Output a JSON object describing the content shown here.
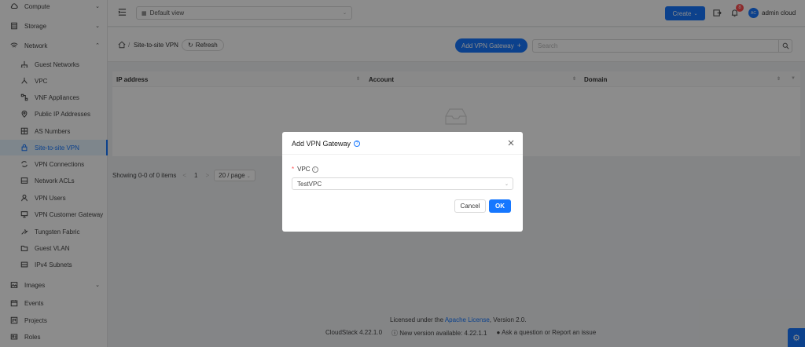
{
  "sidebar": {
    "items": [
      {
        "label": "Compute",
        "icon": "cloud-icon",
        "kind": "top",
        "chevron": "down"
      },
      {
        "label": "Storage",
        "icon": "database-icon",
        "kind": "top",
        "chevron": "down"
      },
      {
        "label": "Network",
        "icon": "wifi-icon",
        "kind": "top",
        "chevron": "up"
      },
      {
        "label": "Guest Networks",
        "icon": "apartment-icon",
        "kind": "sub"
      },
      {
        "label": "VPC",
        "icon": "deployment-unit-icon",
        "kind": "sub"
      },
      {
        "label": "VNF Appliances",
        "icon": "gateway-icon",
        "kind": "sub"
      },
      {
        "label": "Public IP Addresses",
        "icon": "environment-icon",
        "kind": "sub"
      },
      {
        "label": "AS Numbers",
        "icon": "partition-icon",
        "kind": "sub"
      },
      {
        "label": "Site-to-site VPN",
        "icon": "lock-icon",
        "kind": "sub",
        "active": true
      },
      {
        "label": "VPN Connections",
        "icon": "sync-icon",
        "kind": "sub"
      },
      {
        "label": "Network ACLs",
        "icon": "hdd-icon",
        "kind": "sub"
      },
      {
        "label": "VPN Users",
        "icon": "user-icon",
        "kind": "sub"
      },
      {
        "label": "VPN Customer Gateway",
        "icon": "desktop-icon",
        "kind": "sub"
      },
      {
        "label": "Tungsten Fabric",
        "icon": "tool-icon",
        "kind": "sub"
      },
      {
        "label": "Guest VLAN",
        "icon": "folder-icon",
        "kind": "sub"
      },
      {
        "label": "IPv4 Subnets",
        "icon": "block-icon",
        "kind": "sub"
      },
      {
        "label": "Images",
        "icon": "picture-icon",
        "kind": "top",
        "chevron": "down"
      },
      {
        "label": "Events",
        "icon": "schedule-icon",
        "kind": "top"
      },
      {
        "label": "Projects",
        "icon": "project-icon",
        "kind": "top"
      },
      {
        "label": "Roles",
        "icon": "idcard-icon",
        "kind": "top"
      }
    ]
  },
  "header": {
    "view_select": "Default view",
    "create_label": "Create",
    "notification_count": "8",
    "avatar_initials": "AC",
    "username": "admin cloud"
  },
  "toolbar": {
    "breadcrumb_current": "Site-to-site VPN",
    "breadcrumb_sep": "/",
    "refresh_label": "Refresh",
    "add_label": "Add VPN Gateway",
    "search_placeholder": "Search"
  },
  "table": {
    "columns": [
      "IP address",
      "Account",
      "Domain"
    ],
    "rows": []
  },
  "pagination": {
    "summary": "Showing 0-0 of 0 items",
    "prev": "<",
    "page": "1",
    "next": ">",
    "page_size": "20 / page"
  },
  "footer": {
    "license_prefix": "Licensed under the",
    "license_link": "Apache License",
    "license_suffix": ", Version 2.0.",
    "version": "CloudStack 4.22.1.0",
    "new_version": "New version available: 4.22.1.1",
    "issue_link": "Ask a question or Report an issue"
  },
  "modal": {
    "title": "Add VPN Gateway",
    "field_label": "VPC",
    "field_required": "*",
    "field_value": "TestVPC",
    "cancel_label": "Cancel",
    "ok_label": "OK"
  },
  "colors": {
    "primary": "#1677ff",
    "badge": "#ff4d4f",
    "overlay": "rgba(0,0,0,0.45)"
  }
}
